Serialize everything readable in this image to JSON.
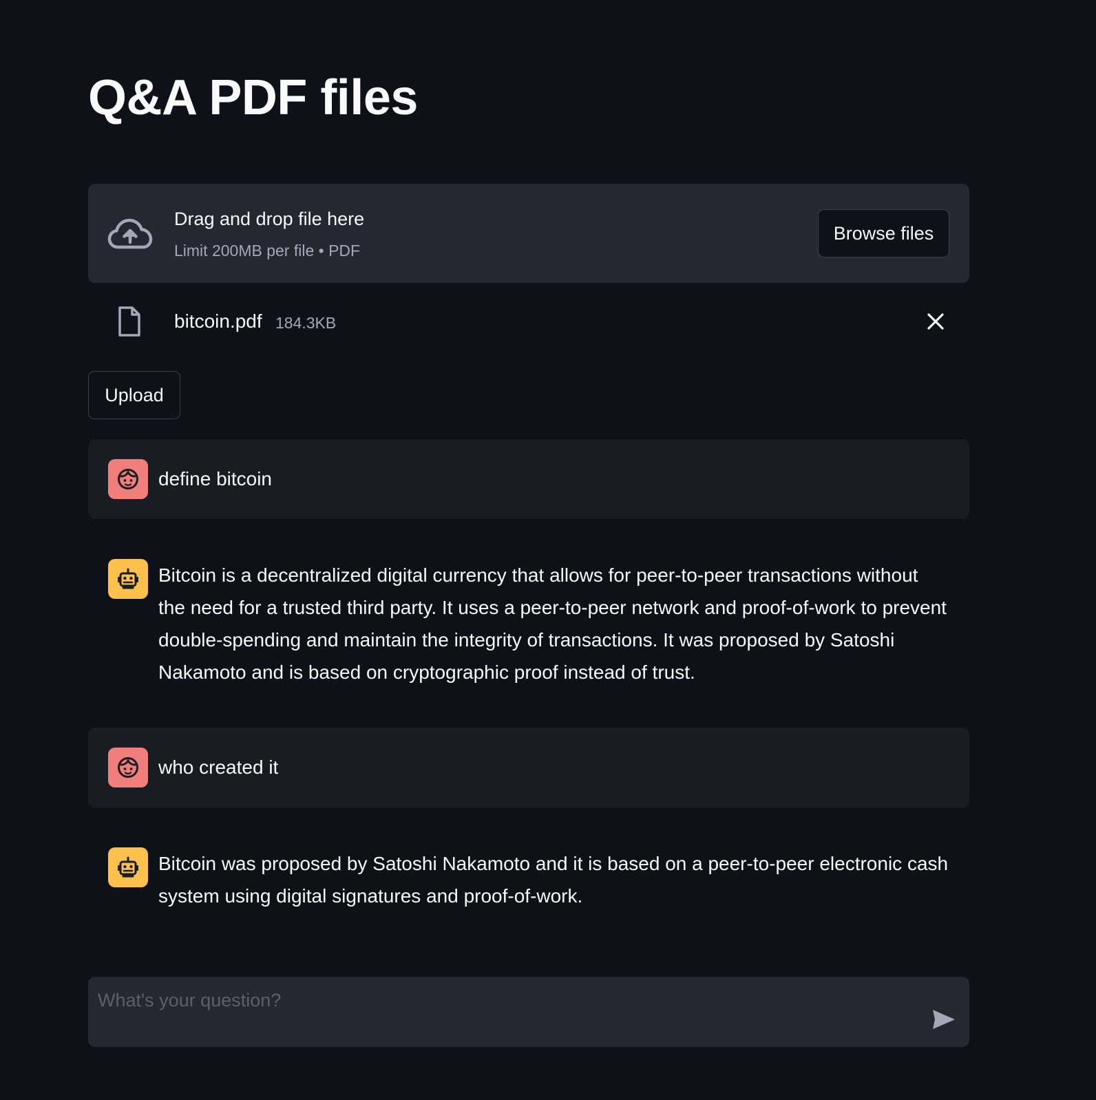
{
  "page": {
    "title": "Q&A PDF files"
  },
  "uploader": {
    "drop_label": "Drag and drop file here",
    "limit_text": "Limit 200MB per file • PDF",
    "browse_label": "Browse files",
    "icon": "cloud-upload-icon"
  },
  "file": {
    "name": "bitcoin.pdf",
    "size": "184.3KB",
    "icon": "file-icon"
  },
  "upload_button": {
    "label": "Upload"
  },
  "messages": [
    {
      "role": "user",
      "avatar_icon": "user-face-icon",
      "text": "define bitcoin"
    },
    {
      "role": "assistant",
      "avatar_icon": "robot-icon",
      "text": "Bitcoin is a decentralized digital currency that allows for peer-to-peer transactions without the need for a trusted third party. It uses a peer-to-peer network and proof-of-work to prevent double-spending and maintain the integrity of transactions. It was proposed by Satoshi Nakamoto and is based on cryptographic proof instead of trust."
    },
    {
      "role": "user",
      "avatar_icon": "user-face-icon",
      "text": "who created it"
    },
    {
      "role": "assistant",
      "avatar_icon": "robot-icon",
      "text": "Bitcoin was proposed by Satoshi Nakamoto and it is based on a peer-to-peer electronic cash system using digital signatures and proof-of-work."
    }
  ],
  "chat_input": {
    "placeholder": "What's your question?",
    "value": "",
    "send_icon": "send-icon"
  },
  "colors": {
    "background": "#0e1117",
    "secondary_background": "#262730",
    "user_message_background": "#1a1c24",
    "user_avatar": "#f07e7b",
    "assistant_avatar": "#fcc04d",
    "muted_text": "#a3a8b8"
  }
}
